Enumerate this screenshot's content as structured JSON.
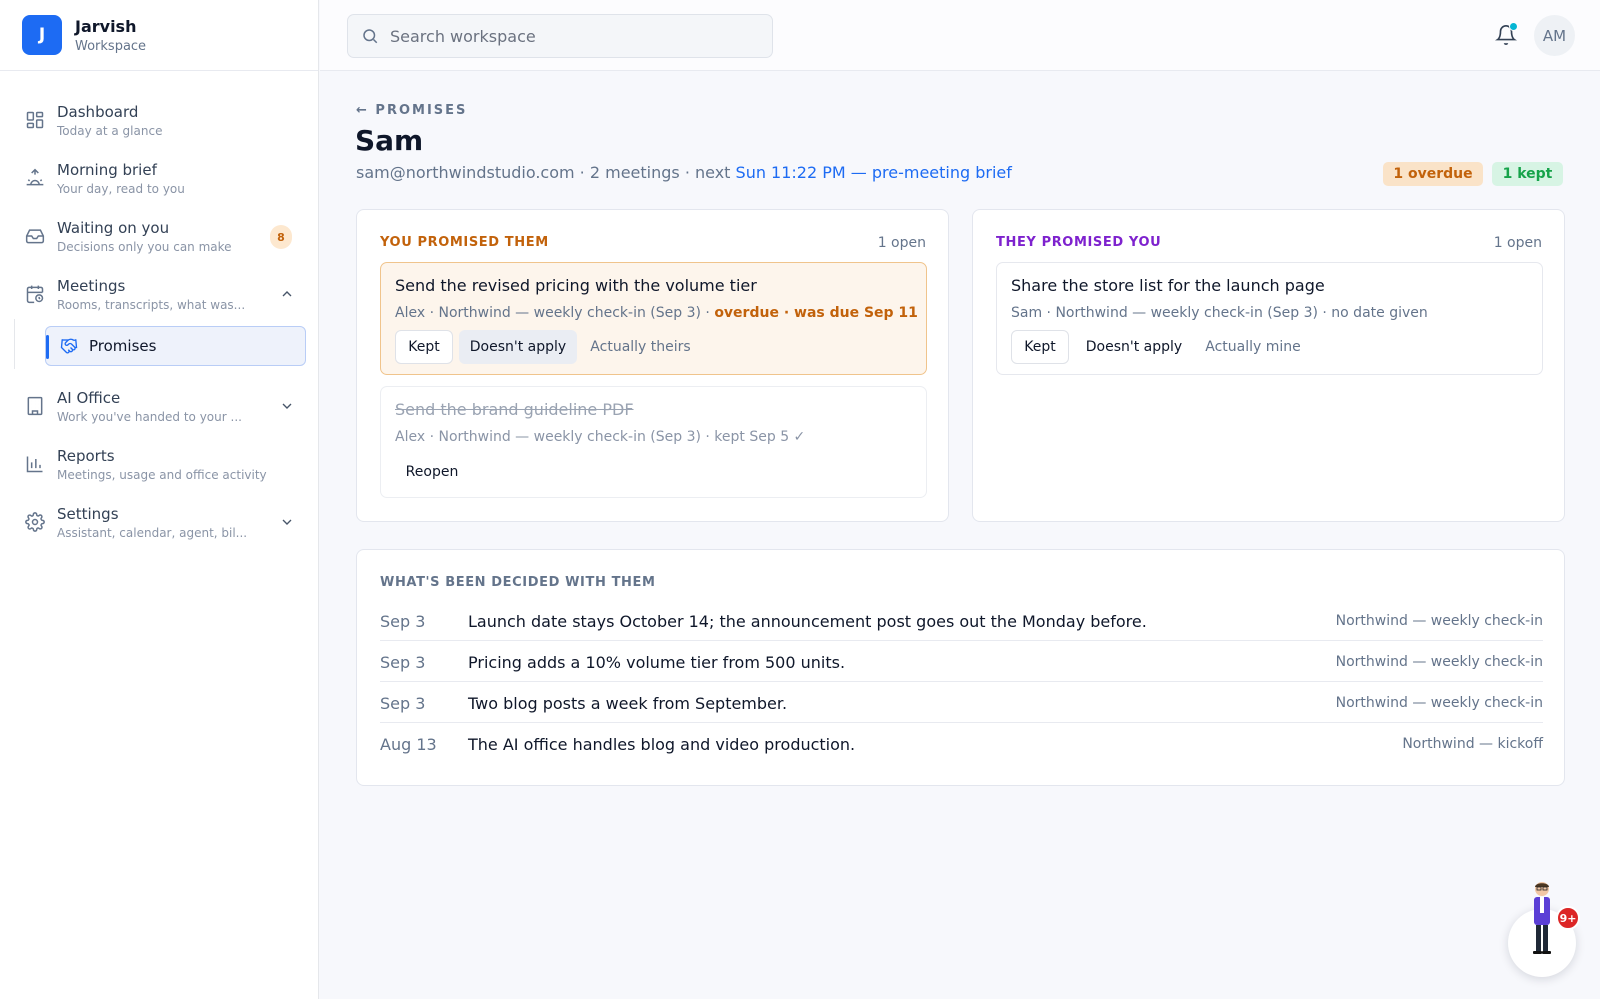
{
  "brand": {
    "logo_letter": "J",
    "name": "Jarvish",
    "subtitle": "Workspace"
  },
  "sidebar": {
    "items": [
      {
        "label": "Dashboard",
        "sub": "Today at a glance",
        "icon": "dashboard-icon"
      },
      {
        "label": "Morning brief",
        "sub": "Your day, read to you",
        "icon": "sunrise-icon"
      },
      {
        "label": "Waiting on you",
        "sub": "Decisions only you can make",
        "icon": "inbox-icon",
        "badge": "8"
      },
      {
        "label": "Meetings",
        "sub": "Rooms, transcripts, what was...",
        "icon": "calendar-clock-icon",
        "expanded": true
      },
      {
        "label": "AI Office",
        "sub": "Work you've handed to your ...",
        "icon": "building-icon",
        "expanded": false
      },
      {
        "label": "Reports",
        "sub": "Meetings, usage and office activity",
        "icon": "bar-chart-icon"
      },
      {
        "label": "Settings",
        "sub": "Assistant, calendar, agent, bil...",
        "icon": "gear-icon",
        "expanded": false
      }
    ],
    "subitem": {
      "label": "Promises",
      "icon": "handshake-icon",
      "active": true
    }
  },
  "topbar": {
    "search_placeholder": "Search workspace",
    "notifications_dot": true,
    "avatar_initials": "AM"
  },
  "page": {
    "back_label": "← PROMISES",
    "title": "Sam",
    "meta_prefix": "sam@northwindstudio.com · 2 meetings · next ",
    "meta_link": "Sun 11:22 PM — pre-meeting brief",
    "pill_overdue": "1 overdue",
    "pill_kept": "1 kept"
  },
  "you_promised": {
    "heading": "YOU PROMISED THEM",
    "count": "1 open",
    "items": [
      {
        "title": "Send the revised pricing with the volume tier",
        "meta": "Alex · Northwind — weekly check-in (Sep 3) · ",
        "warn": "overdue · was due Sep 11",
        "actions": [
          "Kept",
          "Doesn't apply",
          "Actually theirs"
        ]
      },
      {
        "title": "Send the brand guideline PDF",
        "meta": "Alex · Northwind — weekly check-in (Sep 3) · kept Sep 5 ✓",
        "actions": [
          "Reopen"
        ]
      }
    ]
  },
  "they_promised": {
    "heading": "THEY PROMISED YOU",
    "count": "1 open",
    "items": [
      {
        "title": "Share the store list for the launch page",
        "meta": "Sam · Northwind — weekly check-in (Sep 3) · no date given",
        "actions": [
          "Kept",
          "Doesn't apply",
          "Actually mine"
        ]
      }
    ]
  },
  "decisions": {
    "heading": "WHAT'S BEEN DECIDED WITH THEM",
    "rows": [
      {
        "date": "Sep 3",
        "text": "Launch date stays October 14; the announcement post goes out the Monday before.",
        "source": "Northwind — weekly check-in"
      },
      {
        "date": "Sep 3",
        "text": "Pricing adds a 10% volume tier from 500 units.",
        "source": "Northwind — weekly check-in"
      },
      {
        "date": "Sep 3",
        "text": "Two blog posts a week from September.",
        "source": "Northwind — weekly check-in"
      },
      {
        "date": "Aug 13",
        "text": "The AI office handles blog and video production.",
        "source": "Northwind — kickoff"
      }
    ]
  },
  "assistant": {
    "badge": "9+"
  },
  "colors": {
    "accent": "#1d6bf3",
    "overdue": "#c2620b",
    "kept": "#16a34a",
    "they": "#7e22ce"
  }
}
